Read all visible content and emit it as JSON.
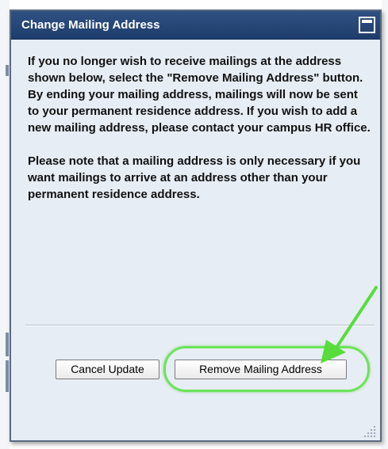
{
  "dialog": {
    "title": "Change Mailing Address",
    "paragraphs": [
      "If you no longer wish to receive mailings at the address shown below, select the \"Remove Mailing Address\" button. By ending your mailing address, mailings will now be sent to your permanent residence address. If you wish to add a new mailing address, please contact your campus HR office.",
      "Please note that a mailing address is only necessary if you want mailings to arrive at an address other than your permanent residence address."
    ],
    "buttons": {
      "cancel_label": "Cancel Update",
      "remove_label": "Remove Mailing Address"
    }
  },
  "icons": {
    "maximize": "maximize-icon",
    "arrow": "annotation-arrow",
    "resize": "resize-grip-icon"
  },
  "colors": {
    "titlebar": "#244676",
    "dialog_background": "#e7edf4",
    "highlight": "#6be35a"
  }
}
